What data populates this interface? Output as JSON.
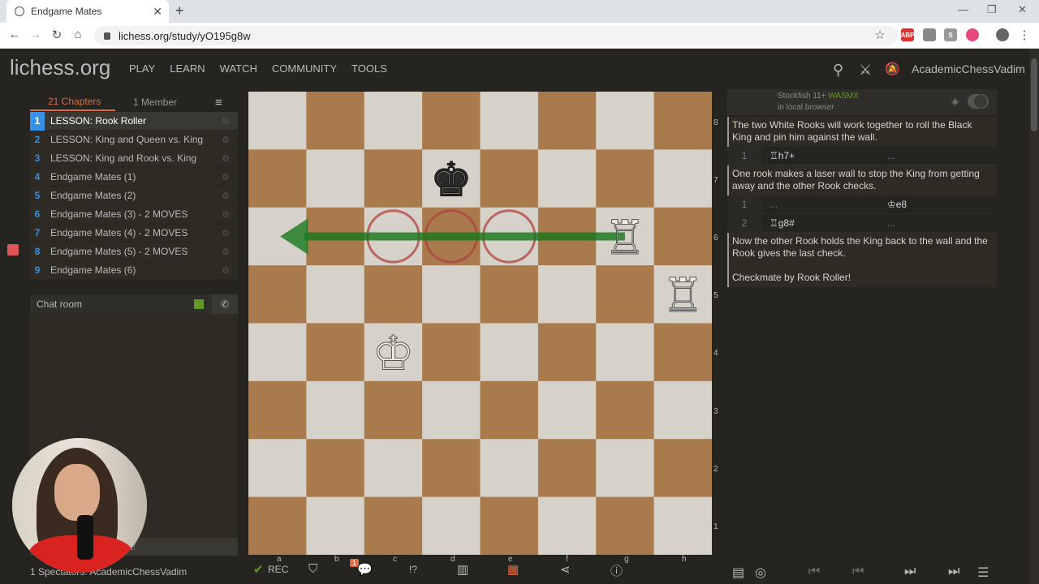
{
  "browser": {
    "tab_title": "Endgame Mates",
    "tab_close": "✕",
    "new_tab": "+",
    "url": "lichess.org/study/yO195g8w",
    "back": "←",
    "forward": "→",
    "reload": "↻",
    "home": "⌂",
    "star": "☆",
    "menu": "⋮",
    "minimize": "—",
    "maximize": "❐",
    "close": "✕",
    "ext_abp": "ABP",
    "ext_s": "S"
  },
  "header": {
    "logo": "lichess.org",
    "nav": [
      "PLAY",
      "LEARN",
      "WATCH",
      "COMMUNITY",
      "TOOLS"
    ],
    "username": "AcademicChessVadim",
    "search_icon": "⚲",
    "swords_icon": "⚔",
    "bell_icon": "🔕"
  },
  "study": {
    "chapters_tab": "21 Chapters",
    "members_tab": "1 Member",
    "menu_icon": "≡",
    "chapters": [
      {
        "num": "1",
        "label": "LESSON: Rook Roller"
      },
      {
        "num": "2",
        "label": "LESSON: King and Queen vs. King"
      },
      {
        "num": "3",
        "label": "LESSON: King and Rook vs. King"
      },
      {
        "num": "4",
        "label": "Endgame Mates (1)"
      },
      {
        "num": "5",
        "label": "Endgame Mates (2)"
      },
      {
        "num": "6",
        "label": "Endgame Mates (3) - 2 MOVES"
      },
      {
        "num": "7",
        "label": "Endgame Mates (4) - 2 MOVES"
      },
      {
        "num": "8",
        "label": "Endgame Mates (5) - 2 MOVES"
      },
      {
        "num": "9",
        "label": "Endgame Mates (6)"
      }
    ],
    "gear": "⚙"
  },
  "chat": {
    "title": "Chat room",
    "phone": "✆",
    "placeholder_visible": "hat!",
    "spectators": "1 Spectators: AcademicChessVadim"
  },
  "board": {
    "ranks": [
      "8",
      "7",
      "6",
      "5",
      "4",
      "3",
      "2",
      "1"
    ],
    "files": [
      "a",
      "b",
      "c",
      "d",
      "e",
      "f",
      "g",
      "h"
    ],
    "pieces": [
      {
        "glyph": "♚",
        "square": "d7",
        "color": "black"
      },
      {
        "glyph": "♖",
        "square": "g6",
        "color": "white"
      },
      {
        "glyph": "♖",
        "square": "h5",
        "color": "white"
      },
      {
        "glyph": "♔",
        "square": "c4",
        "color": "white"
      }
    ],
    "circles": [
      "c6",
      "d6",
      "e6"
    ],
    "arrow": {
      "from": "g6",
      "to": "a6"
    }
  },
  "tools": {
    "rec": "REC",
    "notif_count": "1",
    "check_icon": "✔",
    "tag_icon": "⛉",
    "comment_icon": "💬",
    "glyph_icon": "!?",
    "chart_icon": "▥",
    "grid_icon": "▦",
    "share_icon": "⋖",
    "info_icon": "ⓘ"
  },
  "engine": {
    "name": "Stockfish 11+",
    "wasm": "WASMX",
    "sub": "in local browser",
    "target": "◈"
  },
  "moves": {
    "comment1": "The two White Rooks will work together to roll the Black King and pin him against the wall.",
    "row1": {
      "idx": "1",
      "white": "♖h7+",
      "black": "..."
    },
    "comment2": "One rook makes a laser wall to stop the King from getting away and the other Rook checks.",
    "row1b": {
      "idx": "1",
      "white": "...",
      "black": "♔e8"
    },
    "row2": {
      "idx": "2",
      "white": "♖g8#",
      "black": "..."
    },
    "comment3": "Now the other Rook holds the King back to the wall and the Rook gives the last check.",
    "comment3b": "Checkmate by Rook Roller!"
  },
  "controls": {
    "book": "▤",
    "target": "◎",
    "first": "⏮",
    "prev": "⏮",
    "next": "⏭",
    "last": "⏭",
    "menu": "☰"
  }
}
